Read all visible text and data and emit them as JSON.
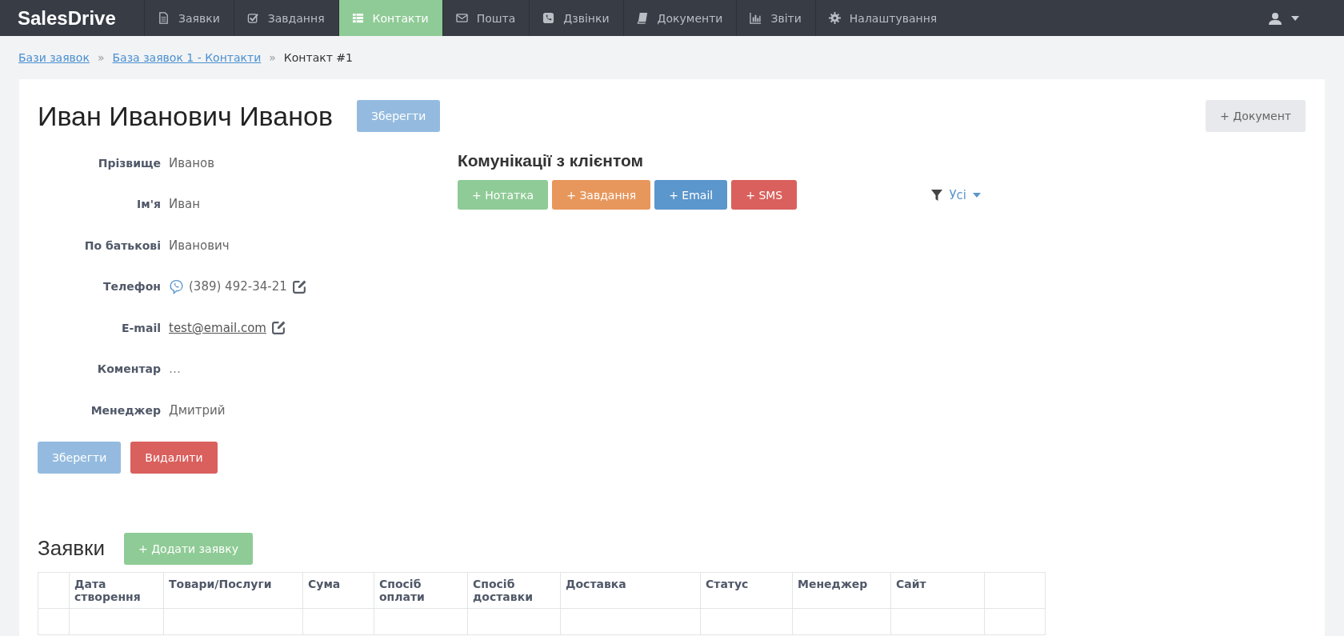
{
  "navbar": {
    "logo": "SalesDrive",
    "items": [
      {
        "label": "Заявки",
        "selected": false
      },
      {
        "label": "Завдання",
        "selected": false
      },
      {
        "label": "Контакти",
        "selected": true
      },
      {
        "label": "Пошта",
        "selected": false
      },
      {
        "label": "Дзвінки",
        "selected": false
      },
      {
        "label": "Документи",
        "selected": false
      },
      {
        "label": "Звіти",
        "selected": false
      },
      {
        "label": "Налаштування",
        "selected": false
      }
    ]
  },
  "breadcrumbs": [
    {
      "label": "Бази заявок",
      "kind": "link"
    },
    {
      "separator": "»",
      "label": "База заявок 1 - Контакти",
      "kind": "link"
    },
    {
      "separator": "»",
      "label": "Контакт #1",
      "kind": "current"
    }
  ],
  "contact": {
    "title": "Иван Иванович Иванов",
    "save_button": "Зберегти",
    "document_button": "+ Документ",
    "fields": [
      {
        "label": "Прізвище",
        "value": "Иванов",
        "kind": "text"
      },
      {
        "label": "Ім'я",
        "value": "Иван",
        "kind": "text"
      },
      {
        "label": "По батькові",
        "value": "Иванович",
        "kind": "text"
      },
      {
        "label": "Телефон",
        "value": "(389) 492-34-21",
        "kind": "phone"
      },
      {
        "label": "E-mail",
        "value": "test@email.com",
        "kind": "email"
      },
      {
        "label": "Коментар",
        "placeholder": "…",
        "kind": "empty"
      },
      {
        "label": "Менеджер",
        "value": "Дмитрий",
        "kind": "text"
      }
    ],
    "bottom_buttons": [
      {
        "label": "Зберегти",
        "kind": "save"
      },
      {
        "label": "Видалити",
        "kind": "delete"
      }
    ]
  },
  "communications": {
    "title": "Комунікації з клієнтом",
    "buttons": [
      {
        "label": "+ Нотатка",
        "color": "#8fcb96"
      },
      {
        "label": "+ Завдання",
        "color": "#e8975c"
      },
      {
        "label": "+ Email",
        "color": "#5b96cc"
      },
      {
        "label": "+ SMS",
        "color": "#d9605d"
      }
    ],
    "filter": "Усі"
  },
  "orders": {
    "title": "Заявки",
    "add_button": "+ Додати заявку",
    "columns": [
      "Дата створення",
      "Товари/Послуги",
      "Сума",
      "Спосіб оплати",
      "Спосіб доставки",
      "Доставка",
      "Статус",
      "Менеджер",
      "Сайт"
    ]
  }
}
